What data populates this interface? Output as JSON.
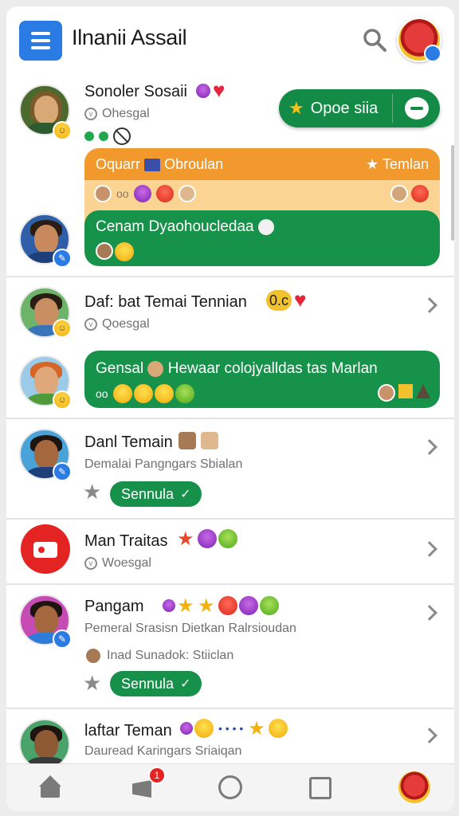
{
  "header": {
    "title": "Ilnanii Assail",
    "menu_icon": "hamburger-menu-icon",
    "search_icon": "search-icon"
  },
  "conversations": [
    {
      "name": "Sonoler Sosaii",
      "sub": "Ohesgal",
      "open_button": "Opoe siia",
      "group_card": {
        "header_left": "Oquarr",
        "header_mid": "Obroulan",
        "header_right": "Temlan",
        "message": "Cenam Dyaohoucledaa"
      }
    },
    {
      "name": "Daf: bat Temai Tennian",
      "sub": "Qoesgal",
      "name_tag": "0.c",
      "message": "Gensal",
      "message_rest": "Hewaar colojyalldas tas Marlan",
      "message_prefix": "oo"
    },
    {
      "name": "Danl Temain",
      "sub": "Demalai Pangngars Sbialan",
      "action": "Sennula"
    },
    {
      "name": "Man Traitas",
      "sub": "Woesgal"
    },
    {
      "name": "Pangam",
      "sub": "Pemeral Srasisn Dietkan Ralrsioudan",
      "sub2": "Inad Sunadok: Stiiclan",
      "action": "Sennula"
    },
    {
      "name": "laftar Teman",
      "sub": "Dauread Karingars Sriaiqan",
      "ellipsis": "• • • •"
    }
  ],
  "bottom_nav": {
    "notif_count": "1"
  },
  "colors": {
    "accent_blue": "#2a7be4",
    "green": "#17924a",
    "orange": "#f2992e",
    "red": "#e42323"
  }
}
